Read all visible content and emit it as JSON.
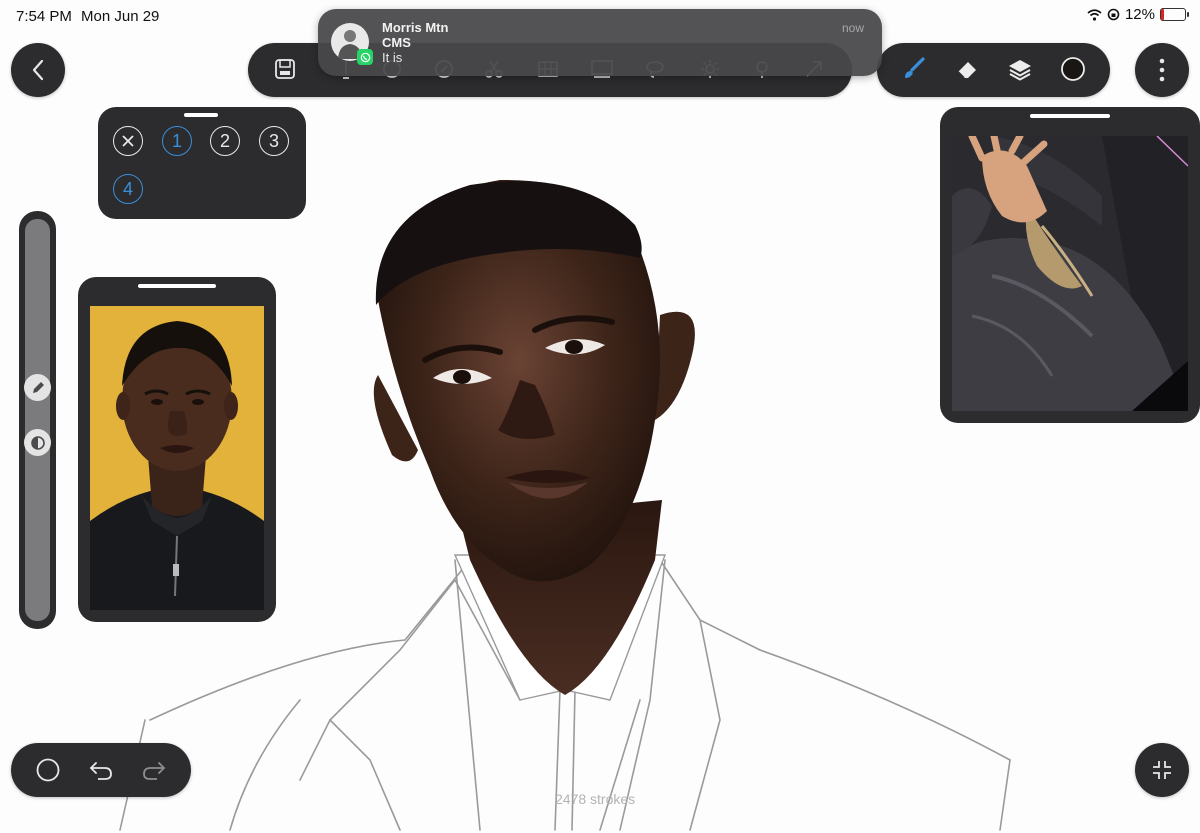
{
  "status_bar": {
    "time": "7:54 PM",
    "date": "Mon Jun 29",
    "battery": "12%",
    "battery_level": 0.12
  },
  "notification": {
    "sender": "Morris Mtn",
    "group": "CMS",
    "message": "It is",
    "time": "now",
    "app_icon": "whatsapp-icon"
  },
  "toolbar": {
    "icons": [
      "save-icon",
      "pen-icon",
      "brush-icon",
      "smudge-icon",
      "scissors-icon",
      "grid-icon",
      "image-icon",
      "lasso-icon",
      "gear-icon",
      "pin-icon",
      "share-icon"
    ]
  },
  "tools_pill": {
    "icons": [
      "brush-icon",
      "eraser-icon",
      "layers-icon",
      "color-swatch-icon"
    ],
    "active": "brush",
    "current_color": "#1a1614",
    "brush_color": "#3a8fd8"
  },
  "brush_sets": {
    "items": [
      "1",
      "2",
      "3",
      "4"
    ],
    "active_color": "#3a8fd8"
  },
  "stroke_count": "2478 strokes"
}
